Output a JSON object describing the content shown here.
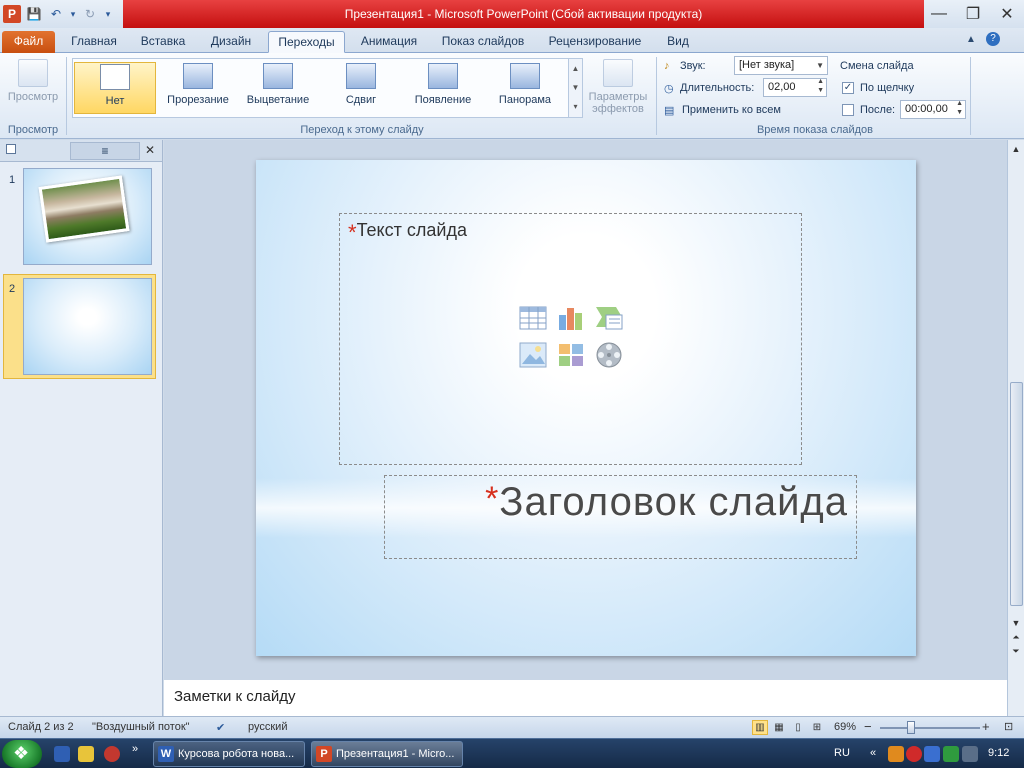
{
  "window": {
    "title": "Презентация1 - Microsoft PowerPoint (Сбой активации продукта)",
    "minimize": "—",
    "maximize": "❐",
    "close": "✕"
  },
  "qat": {
    "logo": "P",
    "save": "💾",
    "undo": "↶",
    "undo_arrow": "▾",
    "redo": "↻",
    "customize": "▾"
  },
  "tabs": [
    {
      "label": "Файл"
    },
    {
      "label": "Главная"
    },
    {
      "label": "Вставка"
    },
    {
      "label": "Дизайн"
    },
    {
      "label": "Переходы"
    },
    {
      "label": "Анимация"
    },
    {
      "label": "Показ слайдов"
    },
    {
      "label": "Рецензирование"
    },
    {
      "label": "Вид"
    }
  ],
  "ribbon": {
    "preview": {
      "label": "Просмотр",
      "group": "Просмотр"
    },
    "transitions": {
      "group": "Переход к этому слайду",
      "items": [
        {
          "label": "Нет"
        },
        {
          "label": "Прорезание"
        },
        {
          "label": "Выцветание"
        },
        {
          "label": "Сдвиг"
        },
        {
          "label": "Появление"
        },
        {
          "label": "Панорама"
        }
      ]
    },
    "effects": {
      "line1": "Параметры",
      "line2": "эффектов"
    },
    "timing": {
      "group": "Время показа слайдов",
      "sound_label": "Звук:",
      "sound_value": "[Нет звука]",
      "duration_label": "Длительность:",
      "duration_value": "02,00",
      "apply_all": "Применить ко всем",
      "advance_title": "Смена слайда",
      "on_click": "По щелчку",
      "on_click_checked": "✓",
      "after": "После:",
      "after_value": "00:00,00"
    }
  },
  "slides_panel": {
    "close": "✕",
    "thumbs": [
      {
        "num": "1"
      },
      {
        "num": "2"
      }
    ]
  },
  "slide": {
    "text_placeholder": "Текст слайда",
    "title_placeholder": "Заголовок слайда",
    "star": "*"
  },
  "notes": {
    "placeholder": "Заметки к слайду"
  },
  "status": {
    "slide_info": "Слайд 2 из 2",
    "theme": "\"Воздушный поток\"",
    "language": "русский",
    "zoom": "69%",
    "zoom_minus": "−",
    "zoom_plus": "+"
  },
  "taskbar": {
    "tasks": [
      {
        "label": "Курсова робота нова...",
        "icon": "W"
      },
      {
        "label": "Презентация1 - Micro...",
        "icon": "P"
      }
    ],
    "lang": "RU",
    "time": "9:12",
    "chevron": "»",
    "tray_chevron": "«"
  },
  "colors": {
    "title_red": "#d42020",
    "file_tab": "#d55f1c",
    "selection": "#ffd763"
  }
}
